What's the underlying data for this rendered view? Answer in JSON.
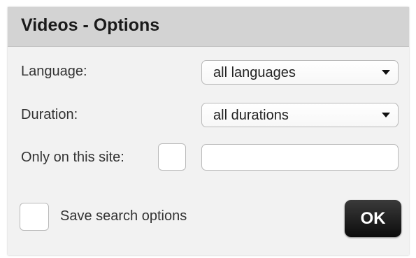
{
  "dialog": {
    "title": "Videos - Options",
    "language": {
      "label": "Language:",
      "selected": "all languages"
    },
    "duration": {
      "label": "Duration:",
      "selected": "all durations"
    },
    "site": {
      "label": "Only on this site:",
      "checked": false,
      "value": ""
    },
    "save": {
      "label": "Save search options",
      "checked": false
    },
    "ok_label": "OK"
  }
}
